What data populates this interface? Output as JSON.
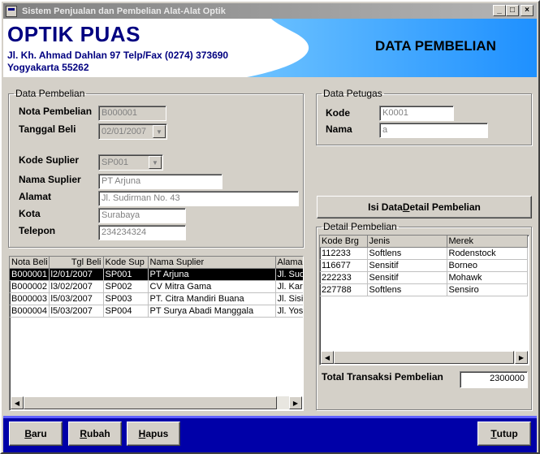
{
  "window": {
    "title": "Sistem Penjualan dan Pembelian Alat-Alat Optik",
    "min": "_",
    "max": "□",
    "close": "×"
  },
  "header": {
    "brand": "OPTIK PUAS",
    "address1": "Jl. Kh. Ahmad Dahlan 97 Telp/Fax (0274) 373690",
    "address2": "Yogyakarta  55262",
    "page_title": "DATA PEMBELIAN"
  },
  "pembelian": {
    "legend": "Data Pembelian",
    "nota_label": "Nota Pembelian",
    "nota_value": "B000001",
    "tanggal_label": "Tanggal Beli",
    "tanggal_value": "02/01/2007",
    "kode_suplier_label": "Kode Suplier",
    "kode_suplier_value": "SP001",
    "nama_suplier_label": "Nama Suplier",
    "nama_suplier_value": "PT Arjuna",
    "alamat_label": "Alamat",
    "alamat_value": "Jl. Sudirman No. 43",
    "kota_label": "Kota",
    "kota_value": "Surabaya",
    "telepon_label": "Telepon",
    "telepon_value": "234234324"
  },
  "petugas": {
    "legend": "Data Petugas",
    "kode_label": "Kode",
    "kode_value": "K0001",
    "nama_label": "Nama",
    "nama_value": "a"
  },
  "isi_button": {
    "pre": "Isi Data ",
    "hot": "D",
    "post": "etail Pembelian"
  },
  "purchase_grid": {
    "headers": [
      "Nota Beli",
      "Tgl Beli",
      "Kode Sup",
      "Nama Suplier",
      "Alama"
    ],
    "rows": [
      [
        "B000001",
        "l2/01/2007",
        "SP001",
        "PT Arjuna",
        "Jl. Sud"
      ],
      [
        "B000002",
        "l3/02/2007",
        "SP002",
        "CV Mitra Gama",
        "Jl. Kar"
      ],
      [
        "B000003",
        "l5/03/2007",
        "SP003",
        "PT. Citra Mandiri Buana",
        "Jl. Sisi"
      ],
      [
        "B000004",
        "l5/03/2007",
        "SP004",
        "PT Surya Abadi Manggala",
        "Jl. Yos"
      ]
    ]
  },
  "detail": {
    "legend": "Detail Pembelian",
    "headers": [
      "Kode Brg",
      "Jenis",
      "Merek"
    ],
    "rows": [
      [
        "112233",
        "Softlens",
        "Rodenstock"
      ],
      [
        "116677",
        "Sensitif",
        "Borneo"
      ],
      [
        "222233",
        "Sensitif",
        "Mohawk"
      ],
      [
        "227788",
        "Softlens",
        "Sensiro"
      ]
    ],
    "total_label": "Total Transaksi Pembelian",
    "total_value": "2300000"
  },
  "buttons": {
    "baru": {
      "hot": "B",
      "rest": "aru"
    },
    "rubah": {
      "hot": "R",
      "rest": "ubah"
    },
    "hapus": {
      "hot": "H",
      "rest": "apus"
    },
    "tutup": {
      "hot": "T",
      "rest": "utup"
    }
  },
  "colors": {
    "brand": "#000080",
    "footer": "#0000a8",
    "header_wave": "#1e90ff"
  }
}
